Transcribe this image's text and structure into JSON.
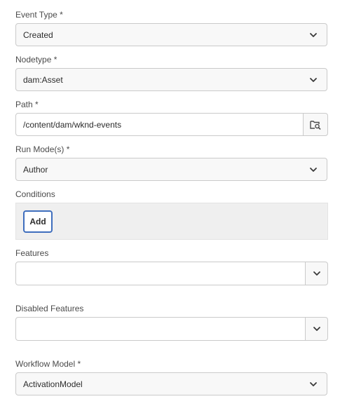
{
  "fields": {
    "event_type": {
      "label": "Event Type *",
      "value": "Created"
    },
    "nodetype": {
      "label": "Nodetype *",
      "value": "dam:Asset"
    },
    "path": {
      "label": "Path *",
      "value": "/content/dam/wknd-events"
    },
    "run_modes": {
      "label": "Run Mode(s) *",
      "value": "Author"
    },
    "conditions": {
      "label": "Conditions",
      "add_label": "Add"
    },
    "features": {
      "label": "Features",
      "value": ""
    },
    "disabled_features": {
      "label": "Disabled Features",
      "value": ""
    },
    "workflow_model": {
      "label": "Workflow Model *",
      "value": "ActivationModel"
    }
  },
  "icons": {
    "dropdown": "chevron-down-icon",
    "browse": "folder-search-icon"
  },
  "colors": {
    "focus_border": "#3f6ebd",
    "field_border": "#cacaca",
    "picker_bg": "#f8f8f8"
  }
}
